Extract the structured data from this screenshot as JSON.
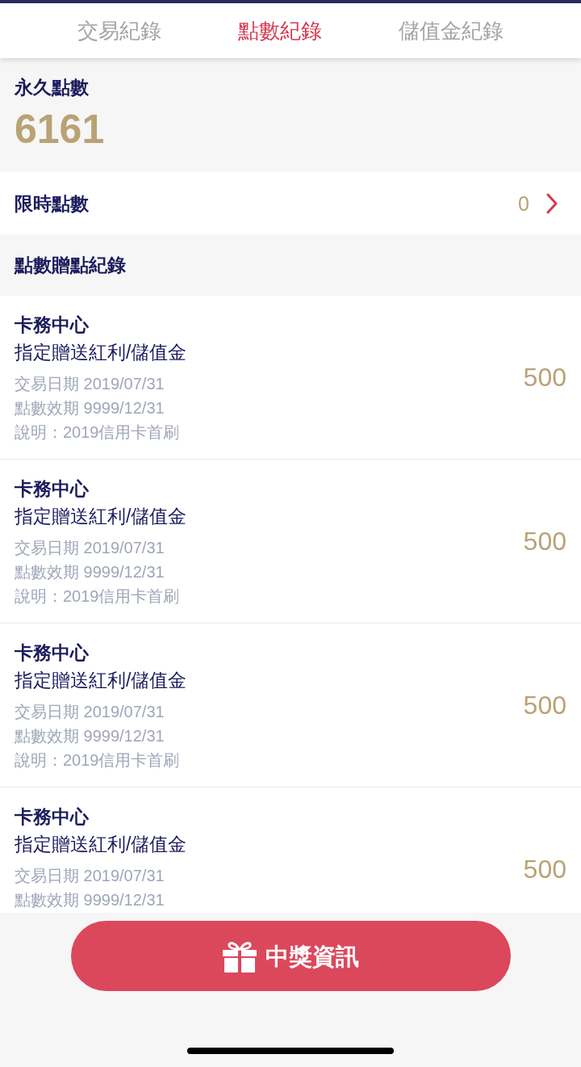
{
  "tabs": [
    {
      "label": "交易紀錄",
      "selected": false
    },
    {
      "label": "點數紀錄",
      "selected": true
    },
    {
      "label": "儲值金紀錄",
      "selected": false
    }
  ],
  "permanent_points": {
    "label": "永久點數",
    "value": "6161"
  },
  "timed_points": {
    "label": "限時點數",
    "value": "0"
  },
  "records_section": {
    "title": "點數贈點紀錄"
  },
  "records": [
    {
      "source": "卡務中心",
      "type": "指定贈送紅利/儲值金",
      "details": [
        "交易日期 2019/07/31",
        "點數效期 9999/12/31",
        "說明：2019信用卡首刷"
      ],
      "amount": "500"
    },
    {
      "source": "卡務中心",
      "type": "指定贈送紅利/儲值金",
      "details": [
        "交易日期 2019/07/31",
        "點數效期 9999/12/31",
        "說明：2019信用卡首刷"
      ],
      "amount": "500"
    },
    {
      "source": "卡務中心",
      "type": "指定贈送紅利/儲值金",
      "details": [
        "交易日期 2019/07/31",
        "點數效期 9999/12/31",
        "說明：2019信用卡首刷"
      ],
      "amount": "500"
    },
    {
      "source": "卡務中心",
      "type": "指定贈送紅利/儲值金",
      "details": [
        "交易日期 2019/07/31",
        "點數效期 9999/12/31"
      ],
      "amount": "500"
    }
  ],
  "prize_button": {
    "label": "中獎資訊"
  }
}
